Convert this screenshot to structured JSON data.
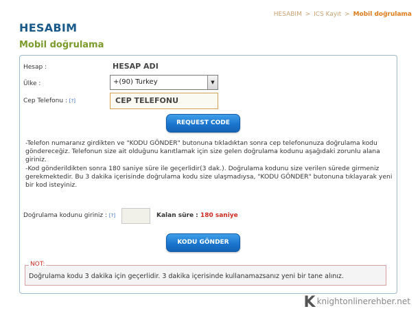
{
  "breadcrumb": {
    "items": [
      "HESABIM",
      "ICS Kayıt",
      "Mobil doğrulama"
    ],
    "separator": ">"
  },
  "page": {
    "title": "HESABIM",
    "subtitle": "Mobil doğrulama"
  },
  "form": {
    "hesap_label": "Hesap :",
    "hesap_value": "HESAP ADI",
    "ulke_label": "Ülke :",
    "ulke_selected": "+(90) Turkey",
    "cep_label": "Cep Telefonu :",
    "help_marker": "[?]",
    "phone_value": "CEP TELEFONU",
    "request_code_button": "REQUEST CODE"
  },
  "info": {
    "paragraph1": "-Telefon numaranız girdikten ve \"KODU GÖNDER\" butonuna tıkladıktan sonra cep telefonunuza doğrulama kodu göndereceğiz. Telefonun size ait olduğunu kanıtlamak için size gelen doğrulama kodunu aşağıdaki zorunlu alana giriniz.",
    "paragraph2": "-Kod gönderildikten sonra 180 saniye süre ile geçerlidir(3 dak.). Doğrulama kodunu size verilen sürede girmeniz gerekmektedir. Bu 3 dakika içerisinde doğrulama kodu size ulaşmadıysa, \"KODU GÖNDER\" butonuna tıklayarak yeni bir kod isteyiniz."
  },
  "verify": {
    "code_label": "Doğrulama kodunu giriniz :",
    "code_value": "",
    "timer_label": "Kalan süre :",
    "timer_value": "180 saniye",
    "send_button": "KODU GÖNDER"
  },
  "note": {
    "title": "NOT:",
    "text": "Doğrulama kodu 3 dakika için geçerlidir. 3 dakika içerisinde kullanamazsanız yeni bir tane alınız."
  },
  "watermark": {
    "logo_text": "knightonlinerehber.net"
  },
  "colors": {
    "title": "#1a5a8a",
    "subtitle": "#7a9a2a",
    "button": "#1b76cf",
    "timer": "#cc2a1f",
    "breadcrumb_current": "#e07a1a"
  }
}
